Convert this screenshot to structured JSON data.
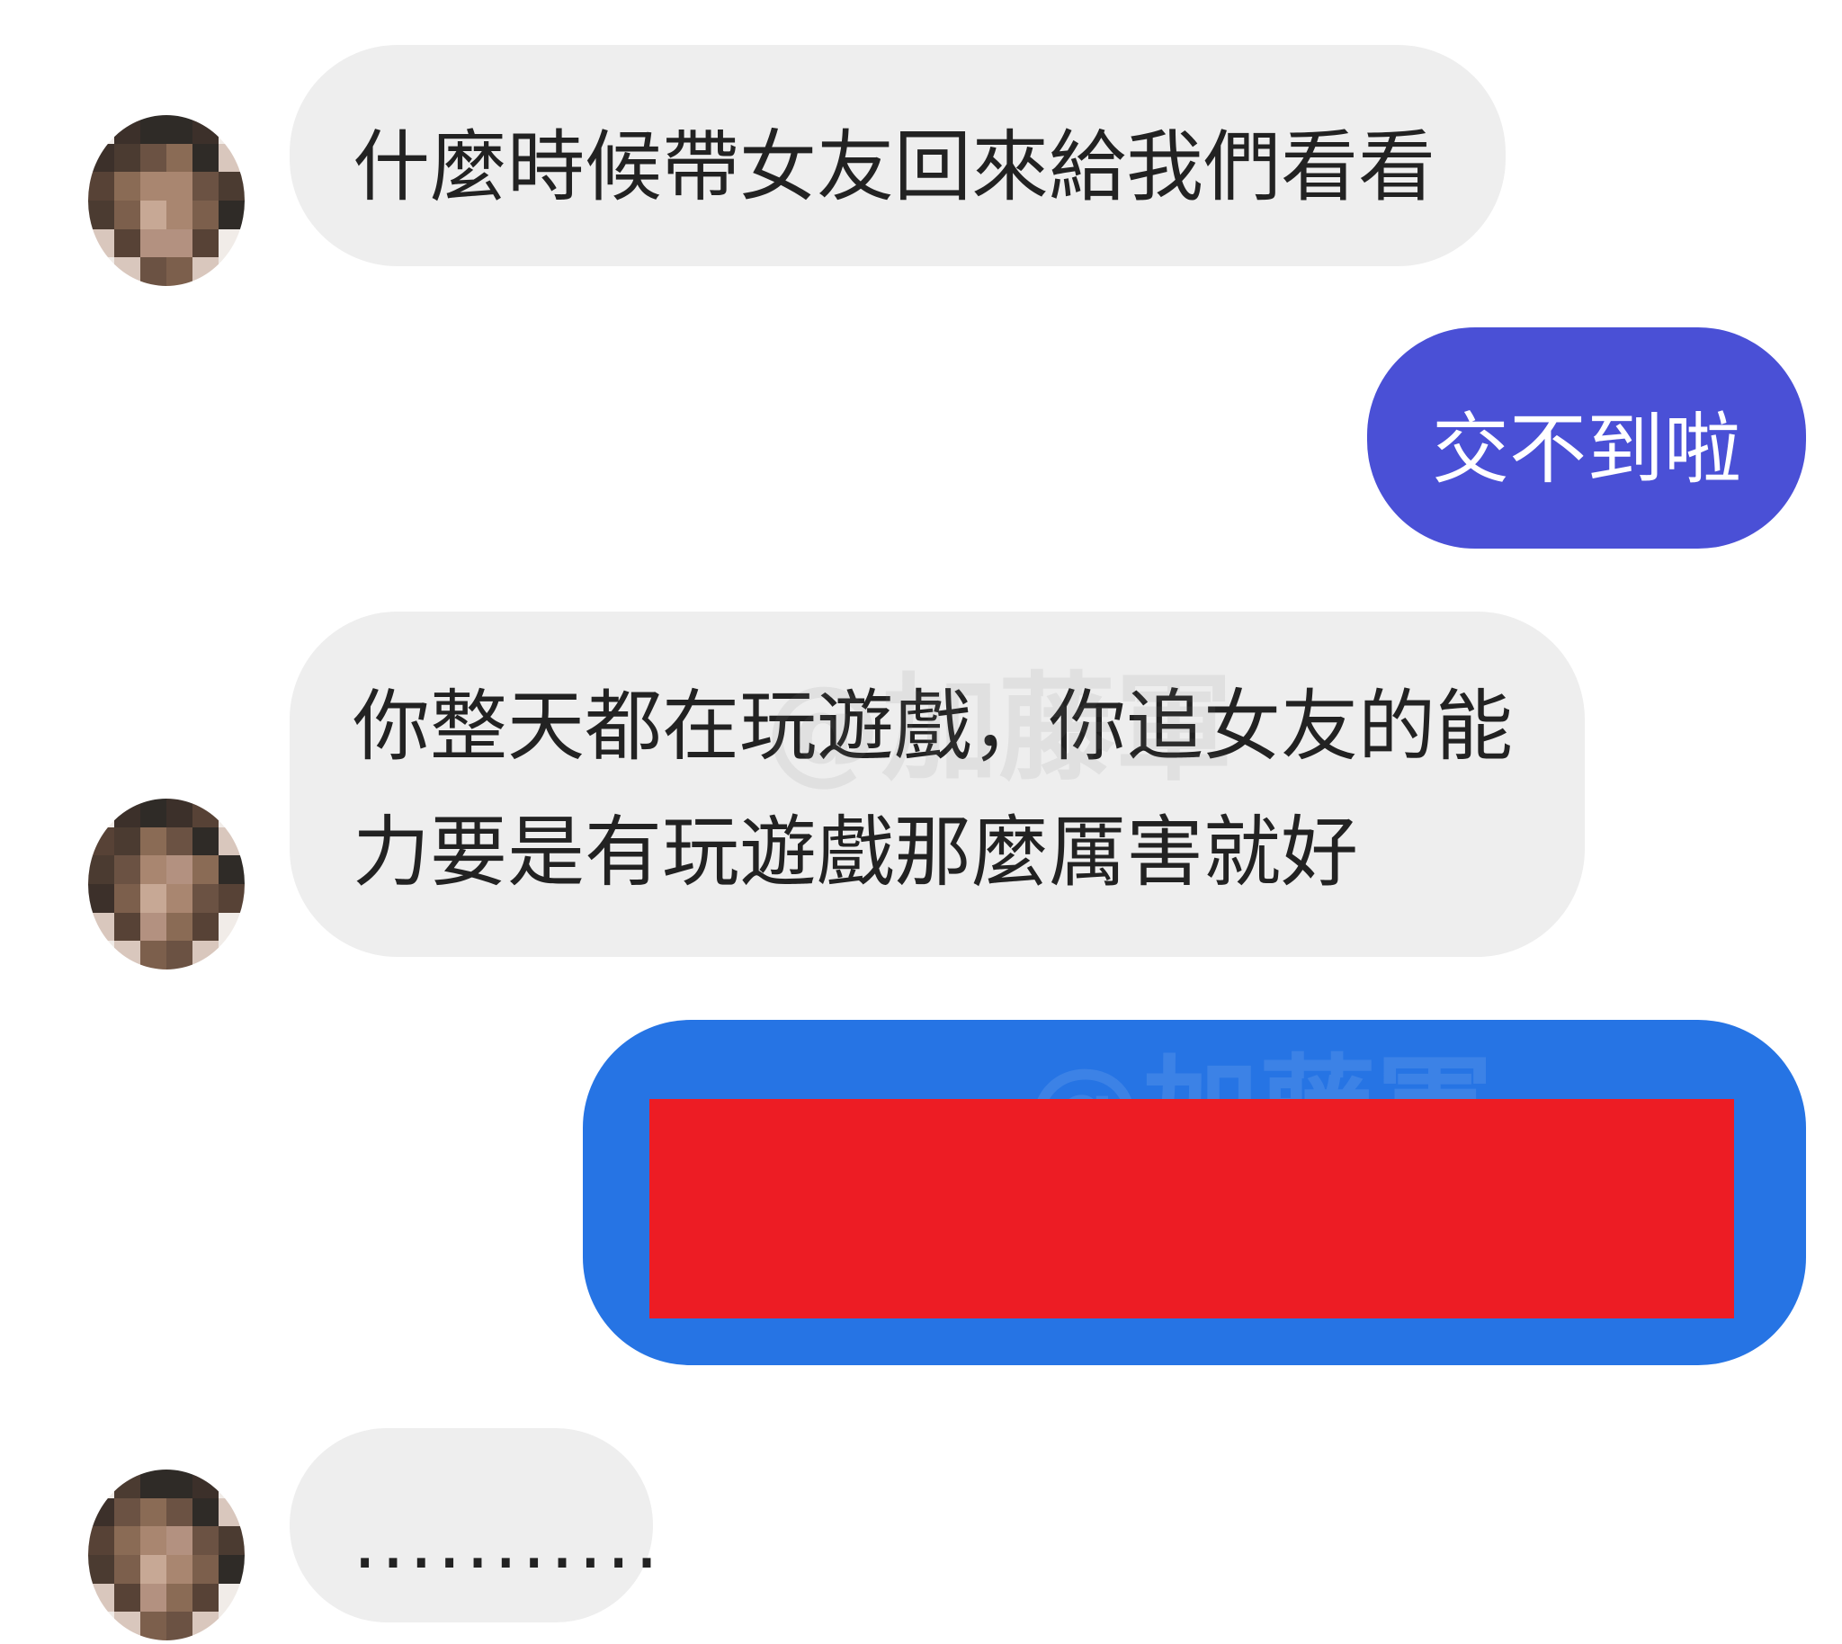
{
  "colors": {
    "incoming_bubble": "#eeeeee",
    "outgoing_bubble_1": "#4a50d6",
    "outgoing_bubble_2": "#2674e4",
    "redaction": "#ed1c24",
    "text": "#222222"
  },
  "messages": [
    {
      "direction": "incoming",
      "text": "什麼時候帶女友回來給我們看看"
    },
    {
      "direction": "outgoing",
      "text": "交不到啦"
    },
    {
      "direction": "incoming",
      "lines": [
        "你整天都在玩遊戲，你追女友的能",
        "力要是有玩遊戲那麼厲害就好"
      ]
    },
    {
      "direction": "outgoing",
      "text": "",
      "redacted": true
    },
    {
      "direction": "incoming",
      "text": "..........."
    }
  ],
  "watermark": "@加藤軍"
}
